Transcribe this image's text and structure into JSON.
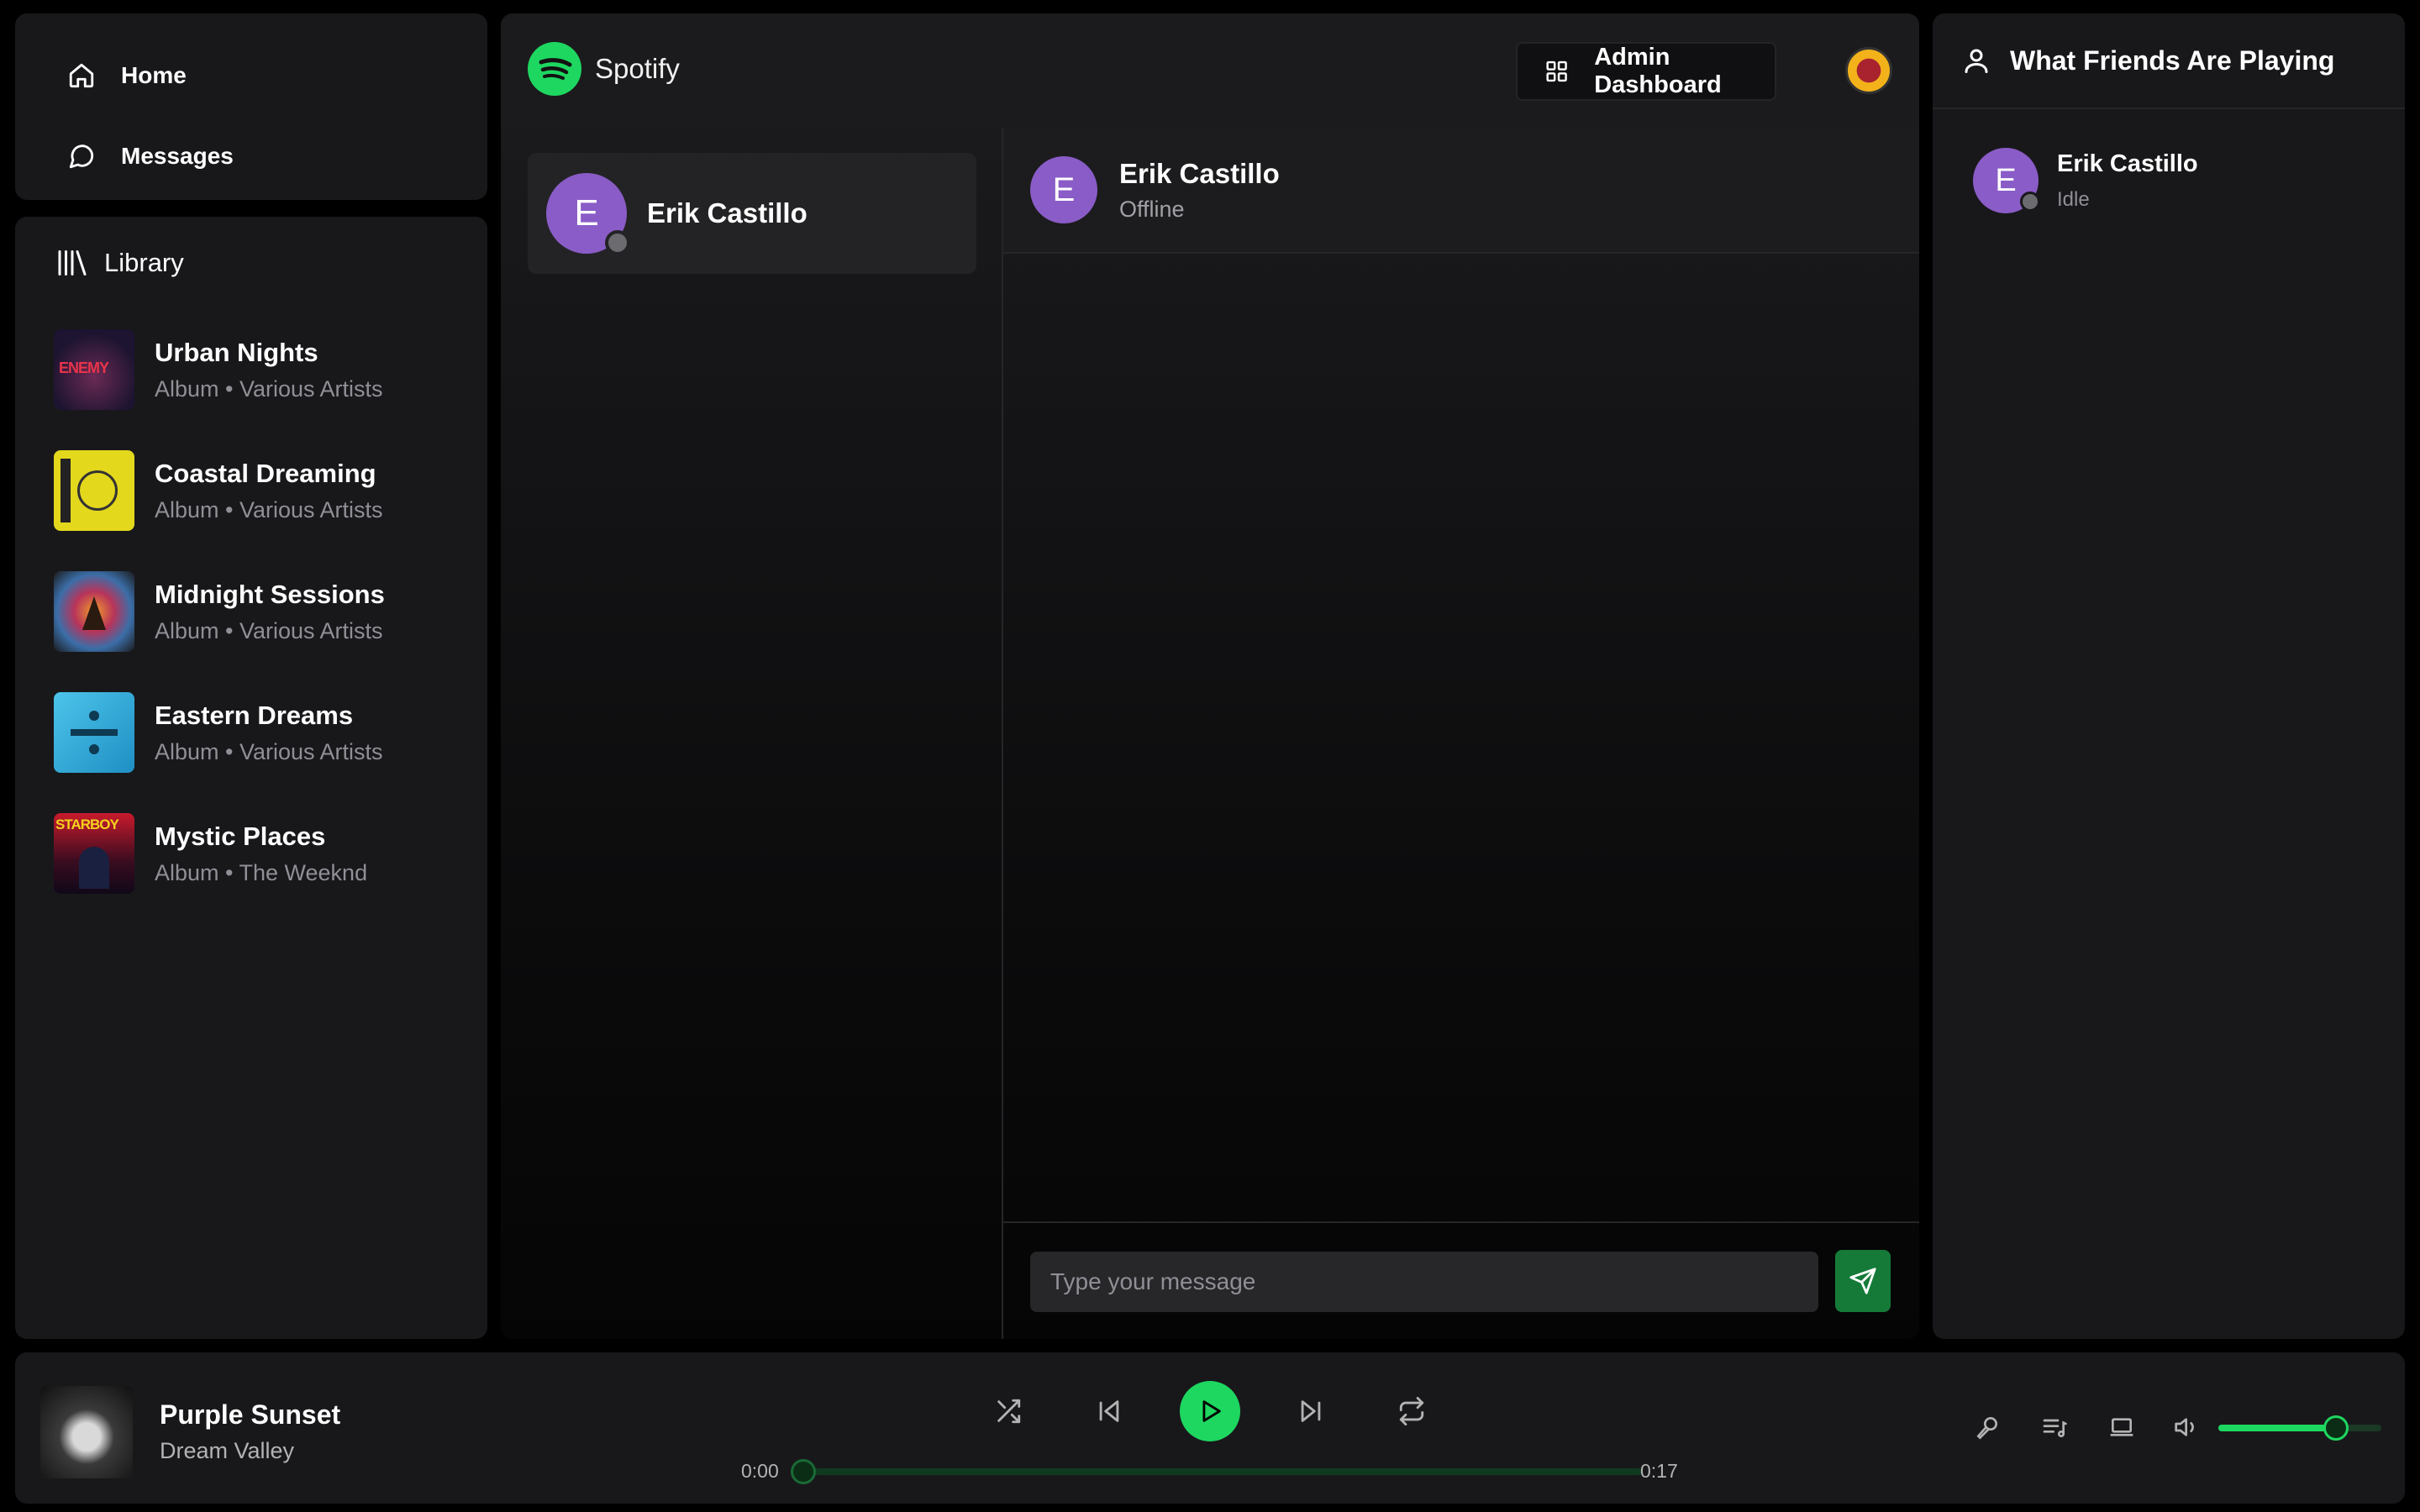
{
  "nav": {
    "items": [
      {
        "label": "Home",
        "icon": "home-icon"
      },
      {
        "label": "Messages",
        "icon": "message-circle-icon"
      }
    ]
  },
  "library": {
    "title": "Library",
    "items": [
      {
        "title": "Urban Nights",
        "subtitle": "Album • Various Artists",
        "art_color": "#2a1f3d",
        "art_text": "ENEMY"
      },
      {
        "title": "Coastal Dreaming",
        "subtitle": "Album • Various Artists",
        "art_color": "#e3d81c"
      },
      {
        "title": "Midnight Sessions",
        "subtitle": "Album • Various Artists",
        "art_color": "#c0553a"
      },
      {
        "title": "Eastern Dreams",
        "subtitle": "Album • Various Artists",
        "art_color": "#2fa9d9"
      },
      {
        "title": "Mystic Places",
        "subtitle": "Album • The Weeknd",
        "art_color": "#1a1a4a",
        "art_text": "STARBOY"
      }
    ]
  },
  "header": {
    "brand": "Spotify",
    "admin_label": "Admin Dashboard"
  },
  "contacts": [
    {
      "initial": "E",
      "name": "Erik Castillo"
    }
  ],
  "chat": {
    "initial": "E",
    "name": "Erik Castillo",
    "status": "Offline",
    "placeholder": "Type your message"
  },
  "friends": {
    "title": "What Friends Are Playing",
    "items": [
      {
        "initial": "E",
        "name": "Erik Castillo",
        "status": "Idle"
      }
    ]
  },
  "player": {
    "title": "Purple Sunset",
    "artist": "Dream Valley",
    "current_time": "0:00",
    "duration": "0:17",
    "progress": 0.0,
    "volume": 0.72
  },
  "colors": {
    "accent": "#1ed760",
    "avatar": "#8a5cc7",
    "panel": "#18181b"
  }
}
